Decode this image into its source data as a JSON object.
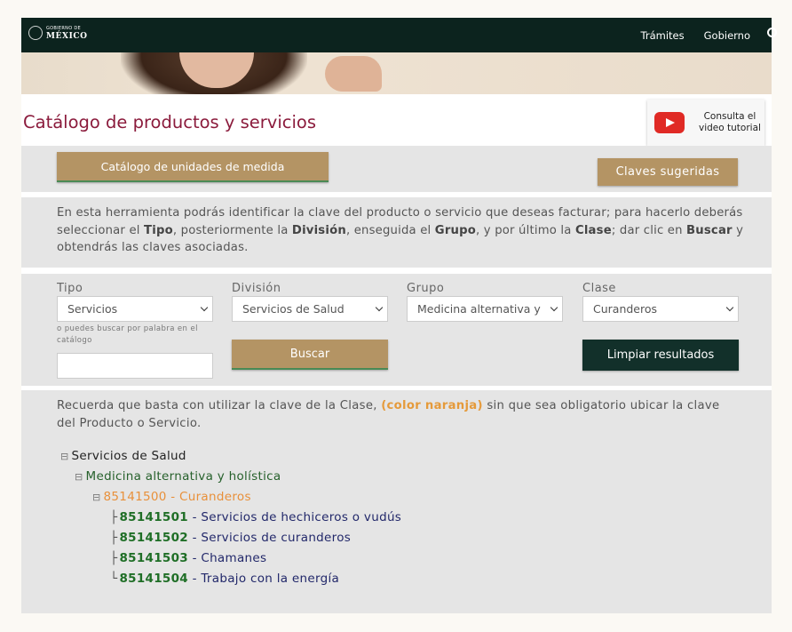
{
  "nav": {
    "logo_small": "GOBIERNO DE",
    "logo_big": "MÉXICO",
    "links": [
      "Trámites",
      "Gobierno"
    ]
  },
  "page": {
    "title": "Catálogo de productos y servicios",
    "tutorial_line1": "Consulta el",
    "tutorial_line2": "video tutorial"
  },
  "buttons": {
    "units": "Catálogo de unidades de medida",
    "claves": "Claves sugeridas",
    "search": "Buscar",
    "clear": "Limpiar resultados"
  },
  "description": {
    "p1": "En esta herramienta podrás identificar la clave del producto o servicio que deseas facturar; para hacerlo deberás seleccionar el ",
    "b1": "Tipo",
    "p2": ", posteriormente la ",
    "b2": "División",
    "p3": ", enseguida el ",
    "b3": "Grupo",
    "p4": ", y por último la ",
    "b4": "Clase",
    "p5": "; dar clic en ",
    "b5": "Buscar",
    "p6": " y obtendrás las claves asociadas."
  },
  "filters": {
    "tipo_label": "Tipo",
    "tipo_value": "Servicios",
    "division_label": "División",
    "division_value": "Servicios de Salud",
    "grupo_label": "Grupo",
    "grupo_value": "Medicina alternativa y",
    "clase_label": "Clase",
    "clase_value": "Curanderos",
    "hint": "o puedes buscar por palabra en el catálogo",
    "search_value": ""
  },
  "note": {
    "p1": "Recuerda que basta con utilizar la clave de la Clase, ",
    "highlight": "(color naranja)",
    "p2": " sin que sea obligatorio ubicar la clave del Producto o Servicio."
  },
  "tree": {
    "division": "Servicios de Salud",
    "grupo": "Medicina alternativa y holística",
    "clase": "85141500 - Curanderos",
    "products": [
      {
        "code": "85141501",
        "name": " - Servicios de hechiceros o vudús"
      },
      {
        "code": "85141502",
        "name": " - Servicios de curanderos"
      },
      {
        "code": "85141503",
        "name": " - Chamanes"
      },
      {
        "code": "85141504",
        "name": " - Trabajo con la energía"
      }
    ]
  },
  "colors": {
    "nav_bg": "#0c231e",
    "title": "#8b1b3c",
    "gold": "#b49464",
    "dark_button": "#12302a",
    "orange": "#e8903a",
    "code_green": "#1f6e26"
  }
}
